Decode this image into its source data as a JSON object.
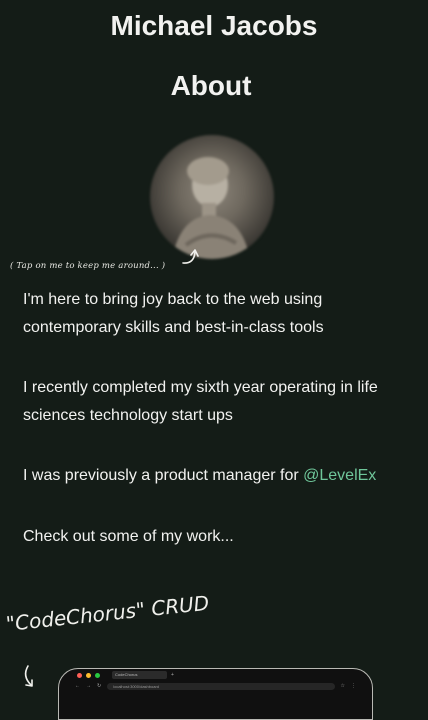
{
  "header": {
    "name": "Michael Jacobs",
    "section_title": "About"
  },
  "avatar": {
    "hint": "( Tap on me to keep me around... )"
  },
  "bio": {
    "p1": "I'm here to bring joy back to the web using contemporary skills and best-in-class tools",
    "p2": "I recently completed my sixth year operating in life sciences technology start ups",
    "p3_prefix": "I was previously a product manager for ",
    "p3_link": "@LevelEx",
    "p4": "Check out some of my work..."
  },
  "work": {
    "label": "\"CodeChorus\" CRUD",
    "preview": {
      "tab_title": "CodeChorus",
      "url": "localhost:3000/dashboard"
    }
  },
  "colors": {
    "background": "#141c17",
    "text": "#f2f2f0",
    "link": "#6fc69a"
  }
}
